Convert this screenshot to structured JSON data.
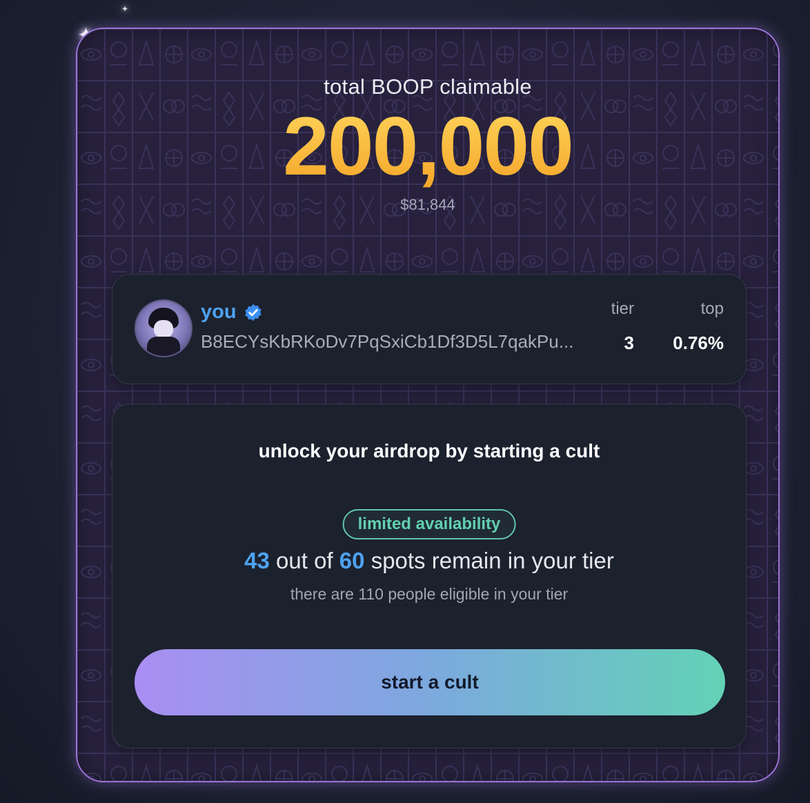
{
  "header": {
    "label": "total BOOP claimable",
    "amount": "200,000",
    "usd_value": "$81,844"
  },
  "user": {
    "name": "you",
    "verified_icon": "verified-badge-icon",
    "avatar_icon": "avatar",
    "wallet": "B8ECYsKbRKoDv7PqSxiCb1Df3D5L7qakPu...",
    "tier_label": "tier",
    "tier_value": "3",
    "top_label": "top",
    "top_value": "0.76%"
  },
  "cult": {
    "title": "unlock your airdrop by starting a cult",
    "badge": "limited availability",
    "spots_remaining": "43",
    "spots_mid": "out of",
    "spots_total": "60",
    "spots_suffix": "spots remain in your tier",
    "eligible_text": "there are 110 people eligible in your tier",
    "button_label": "start a cult"
  },
  "colors": {
    "card_border": "#9b73d6",
    "amount_gold": "#f4b236",
    "accent_blue": "#4fa2ee",
    "badge_green": "#62d0b0",
    "button_gradient_start": "#a98ef2",
    "button_gradient_end": "#63d2b6"
  }
}
